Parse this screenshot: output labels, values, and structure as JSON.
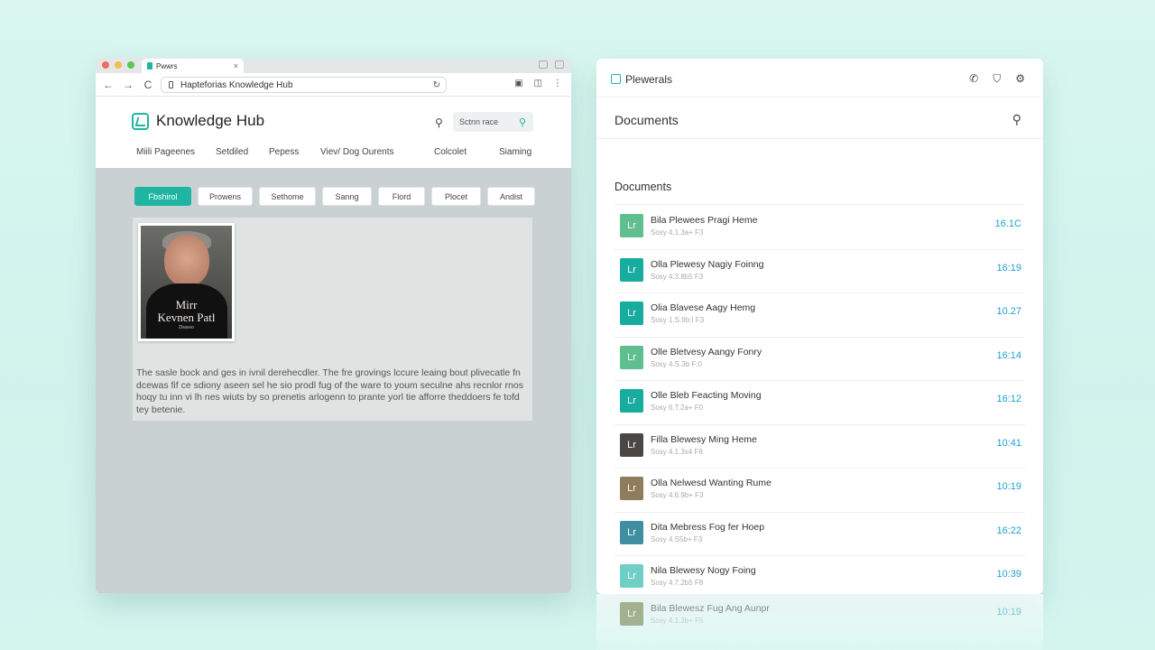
{
  "browser": {
    "tab_title": "Pwwrs",
    "tab_close": "×",
    "url": "Hapteforias Knowledge Hub",
    "nav": {
      "back": "←",
      "forward": "→",
      "reload": "C"
    }
  },
  "site": {
    "logo": "Knowledge Hub",
    "search_placeholder": "Sctnn race",
    "nav_items": [
      "Miili Pageenes",
      "Setdiled",
      "Pepess",
      "Viev/ Dog Ourents",
      "Colcolet",
      "Siaming"
    ],
    "filters": [
      "Fbshirol",
      "Prowens",
      "Sethome",
      "Sanng",
      "Flord",
      "Plocet",
      "Andist"
    ],
    "active_filter": 0,
    "portrait": {
      "name_line1": "Mirr",
      "name_line2": "Kevnen Patl",
      "caption": "Dsssso"
    },
    "article_text": "The sasle bock and ges in ivnil derehecdler. The fre grovings lccure leaing bout plivecatle fn dcewas fif ce sdiony aseen sel he sio prodl fug of the ware to youm seculne ahs recnlor rnos hoqy tu inn vi lh nes wiuts by so prenetis arlogenn to prante yorl tie afforre theddoers fe tofd tey betenie."
  },
  "panel": {
    "app_name": "Plewerals",
    "title": "Documents",
    "section_title": "Documents",
    "documents": [
      {
        "title": "Bila Plewees Pragi Heme",
        "meta": "Sosy 4.1.3a+ F3",
        "time": "16.1C",
        "thumb": "#5fbf8f"
      },
      {
        "title": "Olla Plewesy Nagiy Foinng",
        "meta": "Sosy 4.3.8b5 F3",
        "time": "16:19",
        "thumb": "#17ac9d"
      },
      {
        "title": "Olia Blavese Aagy Hemg",
        "meta": "Sosy 1.S.9b:I F3",
        "time": "10.27",
        "thumb": "#17ac9d"
      },
      {
        "title": "Olle Bletvesy Aangy Fonry",
        "meta": "Sosy 4.S.3b F:0",
        "time": "16:14",
        "thumb": "#5fbf8f"
      },
      {
        "title": "Olle Bleb Feacting Moving",
        "meta": "Sosy 6.T.2a+ F0",
        "time": "16:12",
        "thumb": "#17ac9d"
      },
      {
        "title": "Filla Blewesy Ming Heme",
        "meta": "Sosy 4.1.3x4 F8",
        "time": "10:41",
        "thumb": "#4a4744"
      },
      {
        "title": "Olla Nelwesd Wanting Rume",
        "meta": "Sosy 4.6.9b+ F3",
        "time": "10:19",
        "thumb": "#8f7b5d"
      },
      {
        "title": "Dita Mebress Fog fer Hoep",
        "meta": "Sosy 4.S5b+ F3",
        "time": "16:22",
        "thumb": "#3f8ea2"
      },
      {
        "title": "Nila Blewesy Nogy Foing",
        "meta": "Sosy 4.7.2b5 F8",
        "time": "10:39",
        "thumb": "#6fcfc6"
      }
    ],
    "reflection_doc": {
      "title": "Bila Blewesz Fug Ang Aunpr",
      "meta": "Sosy 4.1.3b+ F5",
      "time": "10:19",
      "thumb": "#6c7a3f"
    }
  }
}
